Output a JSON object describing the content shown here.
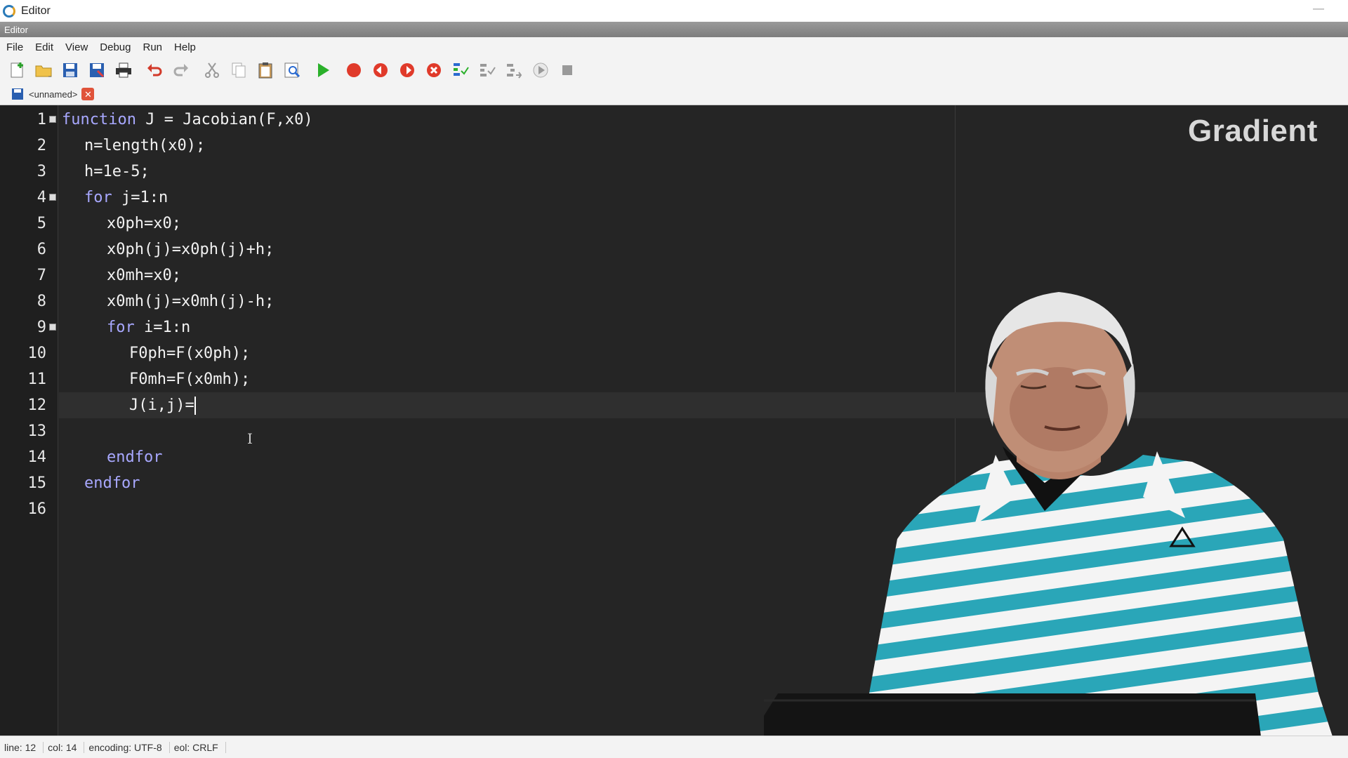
{
  "window": {
    "title": "Editor",
    "dock_title": "Editor"
  },
  "menu": [
    "File",
    "Edit",
    "View",
    "Debug",
    "Run",
    "Help"
  ],
  "toolbar_icons": [
    "new-file-icon",
    "open-folder-icon",
    "save-icon",
    "save-as-icon",
    "print-icon",
    "undo-icon",
    "redo-icon",
    "cut-icon",
    "copy-icon",
    "paste-icon",
    "find-replace-icon",
    "run-icon",
    "breakpoint-icon",
    "previous-breakpoint-icon",
    "next-breakpoint-icon",
    "clear-breakpoints-icon",
    "step-in-icon",
    "step-over-icon",
    "step-out-icon",
    "continue-icon",
    "stop-icon"
  ],
  "tab": {
    "label": "<unnamed>"
  },
  "editor": {
    "line_numbers": [
      "1",
      "2",
      "3",
      "4",
      "5",
      "6",
      "7",
      "8",
      "9",
      "10",
      "11",
      "12",
      "13",
      "14",
      "15",
      "16"
    ],
    "lines": [
      {
        "indent": 0,
        "kw": "function",
        "rest": " J = Jacobian(F,x0)"
      },
      {
        "indent": 1,
        "kw": "",
        "rest": "n=length(x0);"
      },
      {
        "indent": 1,
        "kw": "",
        "rest": "h=1e-5;"
      },
      {
        "indent": 1,
        "kw": "for",
        "rest": " j=1:n"
      },
      {
        "indent": 2,
        "kw": "",
        "rest": "x0ph=x0;"
      },
      {
        "indent": 2,
        "kw": "",
        "rest": "x0ph(j)=x0ph(j)+h;"
      },
      {
        "indent": 2,
        "kw": "",
        "rest": "x0mh=x0;"
      },
      {
        "indent": 2,
        "kw": "",
        "rest": "x0mh(j)=x0mh(j)-h;"
      },
      {
        "indent": 2,
        "kw": "for",
        "rest": " i=1:n"
      },
      {
        "indent": 3,
        "kw": "",
        "rest": "F0ph=F(x0ph);"
      },
      {
        "indent": 3,
        "kw": "",
        "rest": "F0mh=F(x0mh);"
      },
      {
        "indent": 3,
        "kw": "",
        "rest": "J(i,j)="
      },
      {
        "indent": 0,
        "kw": "",
        "rest": ""
      },
      {
        "indent": 2,
        "kw": "endfor",
        "rest": ""
      },
      {
        "indent": 1,
        "kw": "endfor",
        "rest": ""
      },
      {
        "indent": 0,
        "kw": "",
        "rest": ""
      }
    ],
    "fold_lines": [
      1,
      4,
      9
    ],
    "current_line": 12
  },
  "watermark": "Gradient",
  "status": {
    "line": "line: 12",
    "col": "col: 14",
    "encoding": "encoding: UTF-8",
    "eol": "eol: CRLF"
  },
  "colors": {
    "keyword": "#a8a8ff",
    "editor_bg": "#252525",
    "text": "#f2f2f2"
  }
}
